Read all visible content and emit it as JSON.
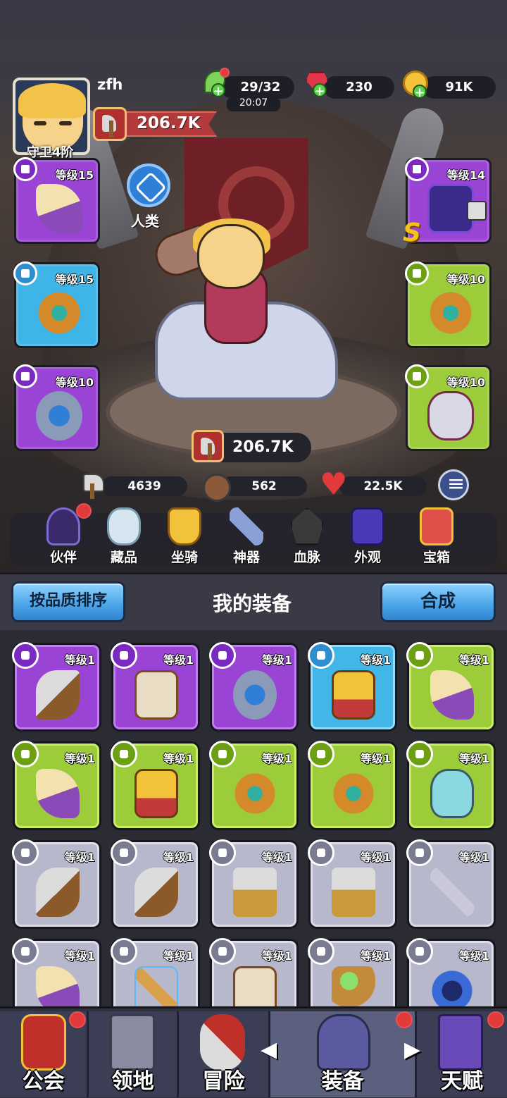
{
  "player": {
    "name": "zfh",
    "tier": "守卫4阶",
    "power": "206.7K"
  },
  "resources": {
    "energy": "29/32",
    "energy_timer": "20:07",
    "gems": "230",
    "gold": "91K"
  },
  "race": "人类",
  "equipped_slots": [
    {
      "level": "等级15",
      "rarity": "purple",
      "item": "bow-icon"
    },
    {
      "level": "等级15",
      "rarity": "blue",
      "item": "ring-icon"
    },
    {
      "level": "等级10",
      "rarity": "purple",
      "item": "amulet-icon"
    },
    {
      "level": "等级14",
      "rarity": "purple",
      "item": "dark-helmet-icon",
      "locked": true,
      "grade": "S"
    },
    {
      "level": "等级10",
      "rarity": "green",
      "item": "ring-icon"
    },
    {
      "level": "等级10",
      "rarity": "green",
      "item": "gem-amulet-icon"
    }
  ],
  "hero_power": "206.7K",
  "stats": {
    "attack": "4639",
    "defense": "562",
    "hp": "22.5K"
  },
  "features": [
    {
      "label": "伙伴",
      "icon": "partner-icon",
      "badge": true
    },
    {
      "label": "藏品",
      "icon": "collection-icon",
      "badge": false
    },
    {
      "label": "坐骑",
      "icon": "mount-icon",
      "badge": false
    },
    {
      "label": "神器",
      "icon": "artifact-icon",
      "badge": false
    },
    {
      "label": "血脉",
      "icon": "bloodline-icon",
      "badge": false
    },
    {
      "label": "外观",
      "icon": "appearance-icon",
      "badge": false
    },
    {
      "label": "宝箱",
      "icon": "chest-icon",
      "badge": false
    }
  ],
  "bag": {
    "sort_label": "按品质排序",
    "title": "我的装备",
    "combine_label": "合成",
    "items": [
      {
        "level": "等级1",
        "rarity": "purple",
        "item": "axe"
      },
      {
        "level": "等级1",
        "rarity": "purple",
        "item": "armor"
      },
      {
        "level": "等级1",
        "rarity": "purple",
        "item": "amulet"
      },
      {
        "level": "等级1",
        "rarity": "blue",
        "item": "goldarmor"
      },
      {
        "level": "等级1",
        "rarity": "green",
        "item": "horn"
      },
      {
        "level": "等级1",
        "rarity": "green",
        "item": "horn"
      },
      {
        "level": "等级1",
        "rarity": "green",
        "item": "goldarmor"
      },
      {
        "level": "等级1",
        "rarity": "green",
        "item": "ring"
      },
      {
        "level": "等级1",
        "rarity": "green",
        "item": "ring"
      },
      {
        "level": "等级1",
        "rarity": "green",
        "item": "mask"
      },
      {
        "level": "等级1",
        "rarity": "gray",
        "item": "axe"
      },
      {
        "level": "等级1",
        "rarity": "gray",
        "item": "axe"
      },
      {
        "level": "等级1",
        "rarity": "gray",
        "item": "hammer"
      },
      {
        "level": "等级1",
        "rarity": "gray",
        "item": "hammer"
      },
      {
        "level": "等级1",
        "rarity": "gray",
        "item": "spear"
      },
      {
        "level": "等级1",
        "rarity": "gray",
        "item": "horn"
      },
      {
        "level": "等级1",
        "rarity": "gray",
        "item": "staff"
      },
      {
        "level": "等级1",
        "rarity": "gray",
        "item": "armor"
      },
      {
        "level": "等级1",
        "rarity": "gray",
        "item": "orb"
      },
      {
        "level": "等级1",
        "rarity": "gray",
        "item": "darkring"
      }
    ]
  },
  "nav": [
    {
      "label": "公会",
      "icon": "guild-icon",
      "badge": true
    },
    {
      "label": "领地",
      "icon": "castle-icon",
      "badge": false
    },
    {
      "label": "冒险",
      "icon": "crossed-axes-icon",
      "badge": false
    },
    {
      "label": "装备",
      "icon": "helmet-icon",
      "badge": true,
      "active": true
    },
    {
      "label": "天赋",
      "icon": "talent-book-icon",
      "badge": true
    }
  ]
}
